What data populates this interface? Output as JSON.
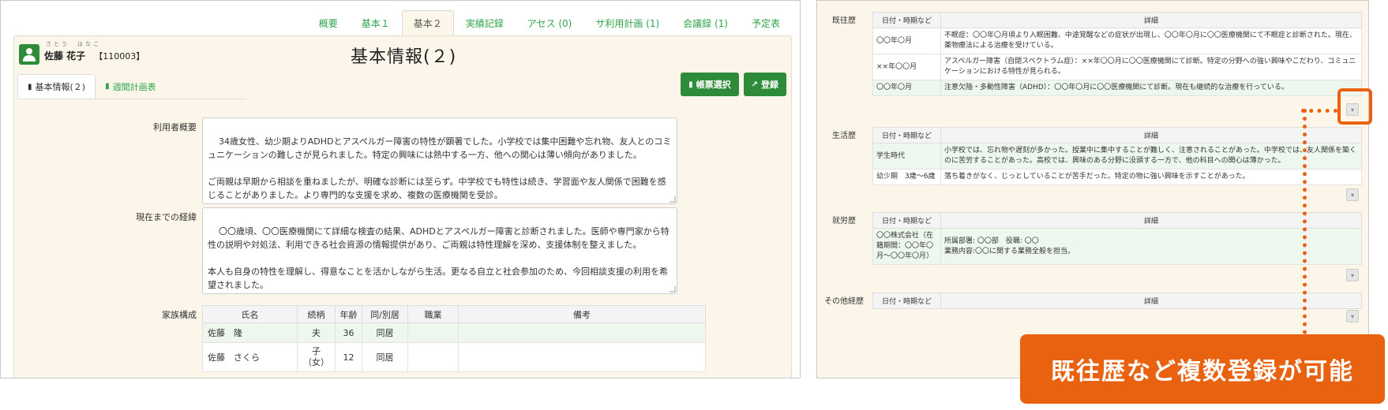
{
  "nav_tabs": [
    "概要",
    "基本１",
    "基本２",
    "実績記録",
    "アセス (0)",
    "サ利用計画 (1)",
    "会議録 (1)",
    "予定表"
  ],
  "user": {
    "ruby": "さとう　はなこ",
    "name": "佐藤 花子",
    "id": "【110003】"
  },
  "page_title": "基本情報(２)",
  "inner_tabs": [
    "基本情報(２)",
    "週間計画表"
  ],
  "buttons": {
    "form_select": "帳票選択",
    "register": "登録"
  },
  "overview": {
    "label": "利用者概要",
    "value": "34歳女性、幼少期よりADHDとアスペルガー障害の特性が顕著でした。小学校では集中困難や忘れ物、友人とのコミュニケーションの難しさが見られました。特定の興味には熱中する一方、他への関心は薄い傾向がありました。\n\nご両親は早期から相談を重ねましたが、明確な診断には至らず。中学校でも特性は続き、学習面や友人関係で困難を感じることがありました。より専門的な支援を求め、複数の医療機関を受診。"
  },
  "history": {
    "label": "現在までの経緯",
    "value": "〇〇歳頃、〇〇医療機関にて詳細な検査の結果、ADHDとアスペルガー障害と診断されました。医師や専門家から特性の説明や対処法、利用できる社会資源の情報提供があり、ご両親は特性理解を深め、支援体制を整えました。\n\n本人も自身の特性を理解し、得意なことを活かしながら生活。更なる自立と社会参加のため、今回相談支援の利用を希望されました。"
  },
  "family": {
    "label": "家族構成",
    "headers": [
      "氏名",
      "続柄",
      "年齢",
      "同/別居",
      "職業",
      "備考"
    ],
    "rows": [
      [
        "佐藤　隆",
        "夫",
        "36",
        "同居",
        "",
        ""
      ],
      [
        "佐藤　さくら",
        "子\n（女）",
        "12",
        "同居",
        "",
        ""
      ]
    ]
  },
  "right": {
    "col_date": "日付・時期など",
    "col_detail": "詳細",
    "sections": [
      {
        "label": "既往歴",
        "rows": [
          [
            "〇〇年〇月",
            "不眠症：〇〇年〇月頃より入眠困難、中途覚醒などの症状が出現し、〇〇年〇月に〇〇医療機関にて不眠症と診断された。現在、薬物療法による治療を受けている。"
          ],
          [
            "××年〇〇月",
            "アスペルガー障害（自閉スペクトラム症）：××年〇〇月に〇〇医療機関にて診断。特定の分野への強い興味やこだわり、コミュニケーションにおける特性が見られる。"
          ],
          [
            "〇〇年〇月",
            "注意欠陥・多動性障害（ADHD）：〇〇年〇月に〇〇医療機関にて診断。現在も継続的な治療を行っている。"
          ]
        ]
      },
      {
        "label": "生活歴",
        "rows": [
          [
            "学生時代",
            "小学校では、忘れ物や遅刻が多かった。授業中に集中することが難しく、注意されることがあった。中学校では、友人関係を築くのに苦労することがあった。高校では、興味のある分野に没頭する一方で、他の科目への関心は薄かった。"
          ],
          [
            "幼少期　3歳〜6歳",
            "落ち着きがなく、じっとしていることが苦手だった。特定の物に強い興味を示すことがあった。"
          ]
        ]
      },
      {
        "label": "就労歴",
        "rows": [
          [
            "〇〇株式会社（在籍期間：〇〇年〇月〜〇〇年〇月）",
            "所属部署: 〇〇部　役職: 〇〇\n業務内容:〇〇に関する業務全般を担当。"
          ]
        ]
      },
      {
        "label": "その他経歴",
        "rows": []
      }
    ]
  },
  "callout_text": "既往歴など複数登録が可能",
  "colors": {
    "accent_green": "#2e8b3a",
    "tab_green": "#2ea24a",
    "callout_orange": "#e8620f",
    "panel_bg": "#fbf6e9"
  }
}
